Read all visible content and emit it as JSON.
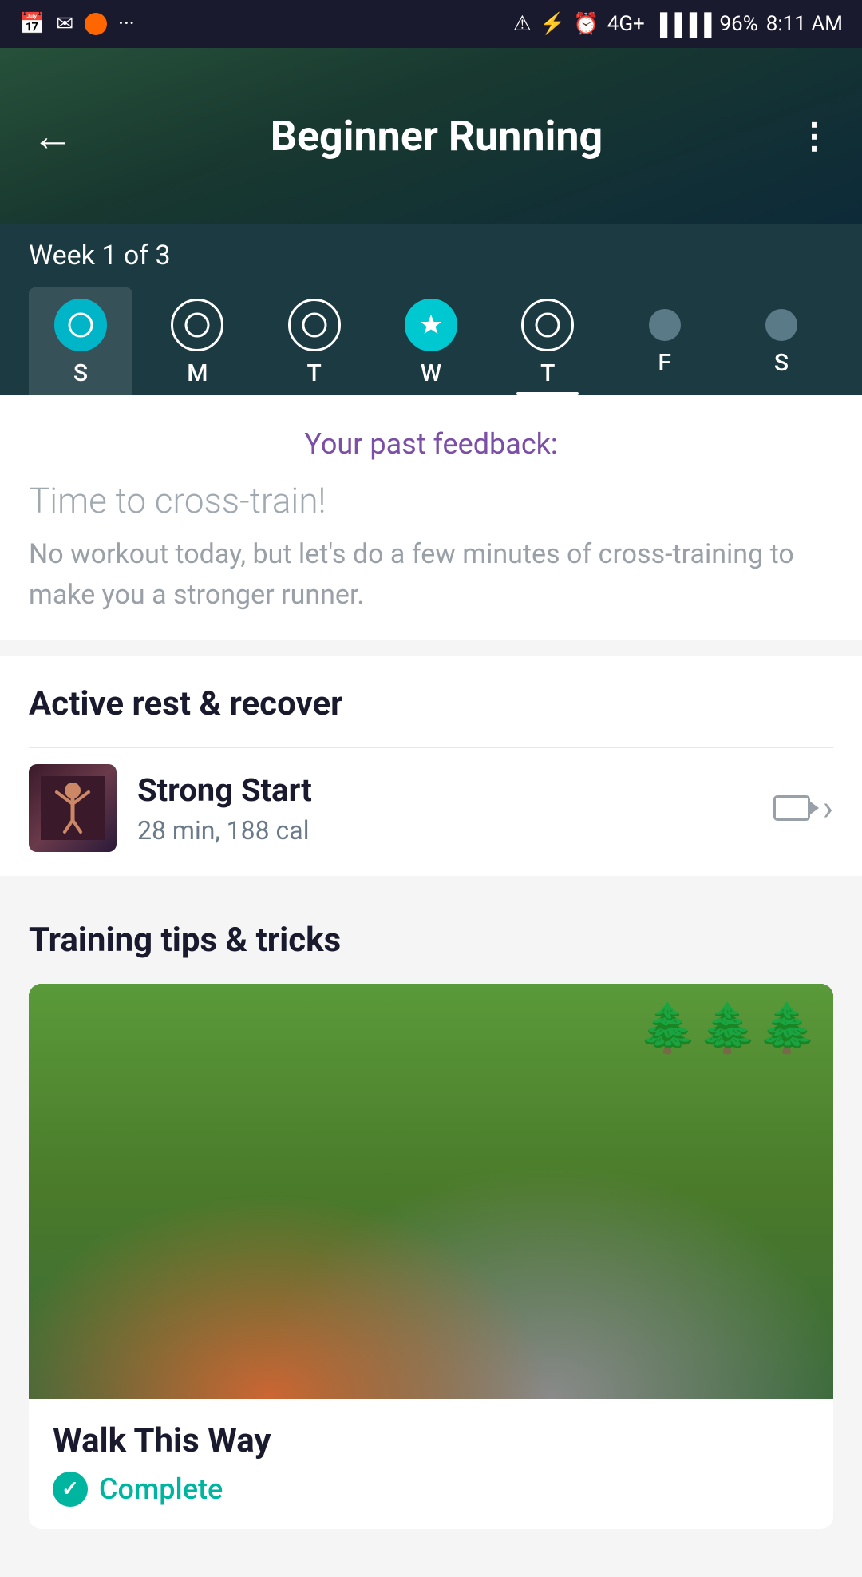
{
  "statusBar": {
    "battery": "96%",
    "time": "8:11 AM",
    "network": "4G+"
  },
  "header": {
    "back_label": "←",
    "title": "Beginner Running",
    "more_label": "⋮"
  },
  "weekNav": {
    "week_label": "Week 1 of 3",
    "days": [
      {
        "letter": "S",
        "state": "circle",
        "active": true
      },
      {
        "letter": "M",
        "state": "circle",
        "active": false
      },
      {
        "letter": "T",
        "state": "circle",
        "active": false
      },
      {
        "letter": "W",
        "state": "star",
        "active": false
      },
      {
        "letter": "T",
        "state": "circle",
        "active": false,
        "underline": true
      },
      {
        "letter": "F",
        "state": "dot",
        "active": false
      },
      {
        "letter": "S",
        "state": "dot",
        "active": false
      }
    ]
  },
  "feedback": {
    "section_title": "Your past feedback:",
    "cross_train_title": "Time to cross-train!",
    "cross_train_desc": "No workout today, but let's do a few minutes of cross-training to make you a stronger runner."
  },
  "activeRest": {
    "section_title": "Active rest & recover",
    "workout": {
      "name": "Strong Start",
      "meta": "28 min, 188 cal"
    }
  },
  "trainingTips": {
    "section_title": "Training tips & tricks",
    "card": {
      "title": "Walk This Way",
      "status": "Complete"
    }
  }
}
